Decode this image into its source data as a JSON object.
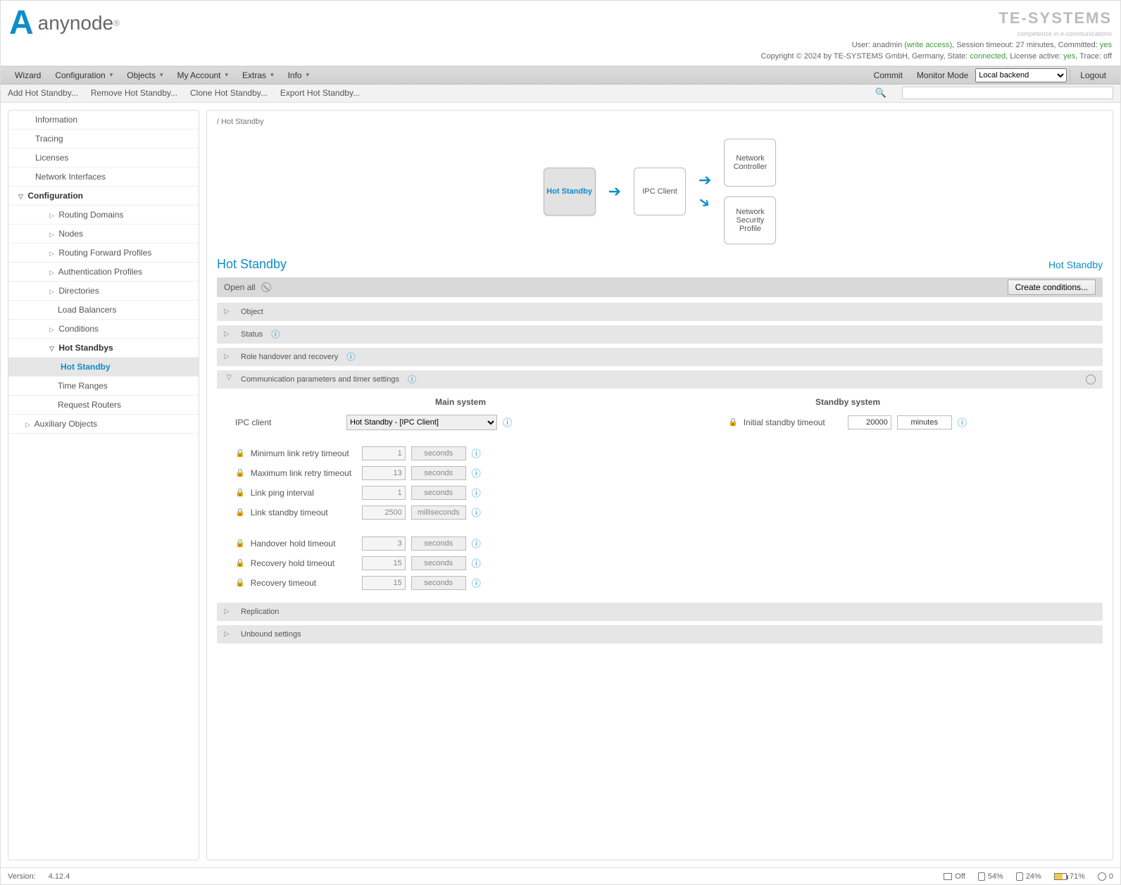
{
  "header": {
    "logo_text": "anynode",
    "brand": "TE-SYSTEMS",
    "brand_sub": "competence in e-communications",
    "user_label": "User:",
    "user": "anadmin",
    "access": "(write access)",
    "session_label": ", Session timeout:",
    "session_value": "27 minutes",
    "committed_label": ", Committed:",
    "committed_value": "yes",
    "copyright": "Copyright © 2024 by TE-SYSTEMS GmbH, Germany, State:",
    "state": "connected",
    "license_label": ", License active:",
    "license_value": "yes",
    "trace_label": ", Trace:",
    "trace_value": "off"
  },
  "menubar": {
    "wizard": "Wizard",
    "configuration": "Configuration",
    "objects": "Objects",
    "my_account": "My Account",
    "extras": "Extras",
    "info": "Info",
    "commit": "Commit",
    "monitor": "Monitor Mode",
    "backend_selected": "Local backend",
    "logout": "Logout"
  },
  "actionbar": {
    "add": "Add Hot Standby...",
    "remove": "Remove Hot Standby...",
    "clone": "Clone Hot Standby...",
    "export": "Export Hot Standby..."
  },
  "sidebar": {
    "information": "Information",
    "tracing": "Tracing",
    "licenses": "Licenses",
    "network_if": "Network Interfaces",
    "configuration": "Configuration",
    "routing_domains": "Routing Domains",
    "nodes": "Nodes",
    "routing_forward": "Routing Forward Profiles",
    "auth_profiles": "Authentication Profiles",
    "directories": "Directories",
    "load_balancers": "Load Balancers",
    "conditions": "Conditions",
    "hot_standbys": "Hot Standbys",
    "hot_standby": "Hot Standby",
    "time_ranges": "Time Ranges",
    "request_routers": "Request Routers",
    "auxiliary": "Auxiliary Objects"
  },
  "breadcrumb": "/ Hot Standby",
  "diagram": {
    "hot_standby": "Hot Standby",
    "ipc_client": "IPC Client",
    "network_controller": "Network Controller",
    "network_security": "Network Security Profile"
  },
  "page_title": "Hot Standby",
  "page_title_right": "Hot Standby",
  "toolbar": {
    "open_all": "Open all",
    "create_conditions": "Create conditions..."
  },
  "sections": {
    "object": "Object",
    "status": "Status",
    "role": "Role handover and recovery",
    "comm": "Communication parameters and timer settings",
    "replication": "Replication",
    "unbound": "Unbound settings"
  },
  "form": {
    "main_heading": "Main system",
    "standby_heading": "Standby system",
    "ipc_client_label": "IPC client",
    "ipc_client_value": "Hot Standby - [IPC Client]",
    "initial_standby_label": "Initial standby timeout",
    "initial_standby_value": "20000",
    "initial_standby_unit": "minutes",
    "min_link_retry_label": "Minimum link retry timeout",
    "min_link_retry_value": "1",
    "max_link_retry_label": "Maximum link retry timeout",
    "max_link_retry_value": "13",
    "link_ping_label": "Link ping interval",
    "link_ping_value": "1",
    "link_standby_label": "Link standby timeout",
    "link_standby_value": "2500",
    "handover_hold_label": "Handover hold timeout",
    "handover_hold_value": "3",
    "recovery_hold_label": "Recovery hold timeout",
    "recovery_hold_value": "15",
    "recovery_timeout_label": "Recovery timeout",
    "recovery_timeout_value": "15",
    "unit_seconds": "seconds",
    "unit_milliseconds": "milliseconds"
  },
  "footer": {
    "version_label": "Version:",
    "version": "4.12.4",
    "off": "Off",
    "disk": "54%",
    "cpu": "24%",
    "battery": "71%",
    "net": "0"
  }
}
